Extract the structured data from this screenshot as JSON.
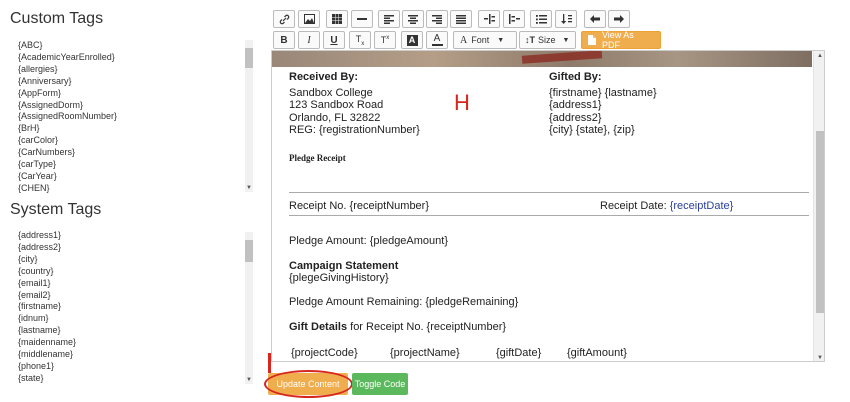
{
  "custom_tags": {
    "title": "Custom Tags",
    "items": [
      "{ABC}",
      "{AcademicYearEnrolled}",
      "{allergies}",
      "{Anniversary}",
      "{AppForm}",
      "{AssignedDorm}",
      "{AssignedRoomNumber}",
      "{BrH}",
      "{carColor}",
      "{CarNumbers}",
      "{carType}",
      "{CarYear}",
      "{CHEN}"
    ]
  },
  "system_tags": {
    "title": "System Tags",
    "items": [
      "{address1}",
      "{address2}",
      "{city}",
      "{country}",
      "{email1}",
      "{email2}",
      "{firstname}",
      "{idnum}",
      "{lastname}",
      "{maidenname}",
      "{middlename}",
      "{phone1}",
      "{state}"
    ]
  },
  "toolbar": {
    "font_label": "Font",
    "size_label": "Size",
    "view_pdf_label": "View As PDF"
  },
  "editor": {
    "received_by_heading": "Received By:",
    "received_lines": [
      "Sandbox College",
      "123 Sandbox Road",
      "Orlando, FL 32822",
      "REG: {registrationNumber}"
    ],
    "gifted_by_heading": "Gifted By:",
    "gifted_lines": [
      "{firstname} {lastname}",
      "{address1}",
      "{address2}",
      "{city} {state}, {zip}"
    ],
    "pledge_receipt_title": "Pledge Receipt",
    "receipt_no": "Receipt No. {receiptNumber}",
    "receipt_date_label": "Receipt Date:",
    "receipt_date_value": "{receiptDate}",
    "pledge_amount": "Pledge Amount: {pledgeAmount}",
    "campaign_heading": "Campaign Statement",
    "campaign_value": "{plegeGivingHistory}",
    "pledge_remaining": "Pledge Amount Remaining: {pledgeRemaining}",
    "gift_details_bold": "Gift Details",
    "gift_details_rest": " for Receipt No. {receiptNumber}",
    "gift_columns": [
      "{projectCode}",
      "{projectName}",
      "{giftDate}",
      "{giftAmount}"
    ]
  },
  "buttons": {
    "update_content": "Update Content",
    "toggle_code": "Toggle Code"
  },
  "annotations": {
    "letter_h": "H"
  },
  "colors": {
    "accent_orange": "#f0ad4e",
    "accent_green": "#5cb85c",
    "annotation_red": "#d7261e",
    "link_blue": "#2a3f9a"
  }
}
